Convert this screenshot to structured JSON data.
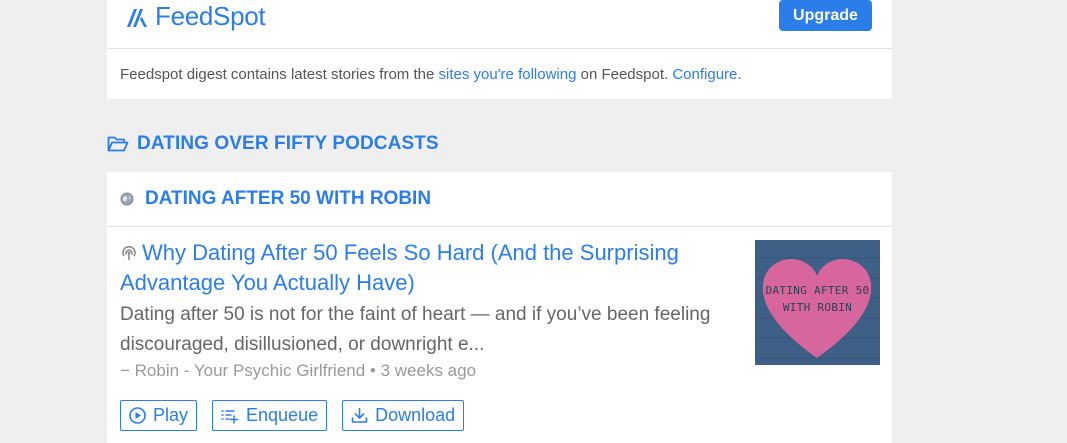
{
  "header": {
    "brand": "FeedSpot",
    "upgrade_label": "Upgrade"
  },
  "digest": {
    "prefix": "Feedspot digest contains latest stories from the ",
    "sites_link": "sites you're following",
    "middle": " on Feedspot. ",
    "configure_link": "Configure",
    "suffix": "."
  },
  "folder": {
    "title": "DATING OVER FIFTY PODCASTS",
    "icon": "folder-open-icon"
  },
  "feed": {
    "title": "DATING AFTER 50 WITH ROBIN",
    "icon": "globe-icon",
    "item": {
      "title": "Why Dating After 50 Feels So Hard (And the Surprising Advantage You Actually Have)",
      "description": "Dating after 50 is not for the faint of heart — and if you’ve been feeling discouraged, disillusioned, or downright e...",
      "meta": "− Robin - Your Psychic Girlfriend • 3 weeks ago",
      "thumbnail_text_line1": "DATING AFTER 50",
      "thumbnail_text_line2": "WITH ROBIN",
      "actions": {
        "play": "Play",
        "enqueue": "Enqueue",
        "download": "Download"
      }
    }
  },
  "colors": {
    "accent": "#2b7de9",
    "background": "#efefef",
    "heart": "#d7669d",
    "thumb_bg": "#3e5f86"
  }
}
